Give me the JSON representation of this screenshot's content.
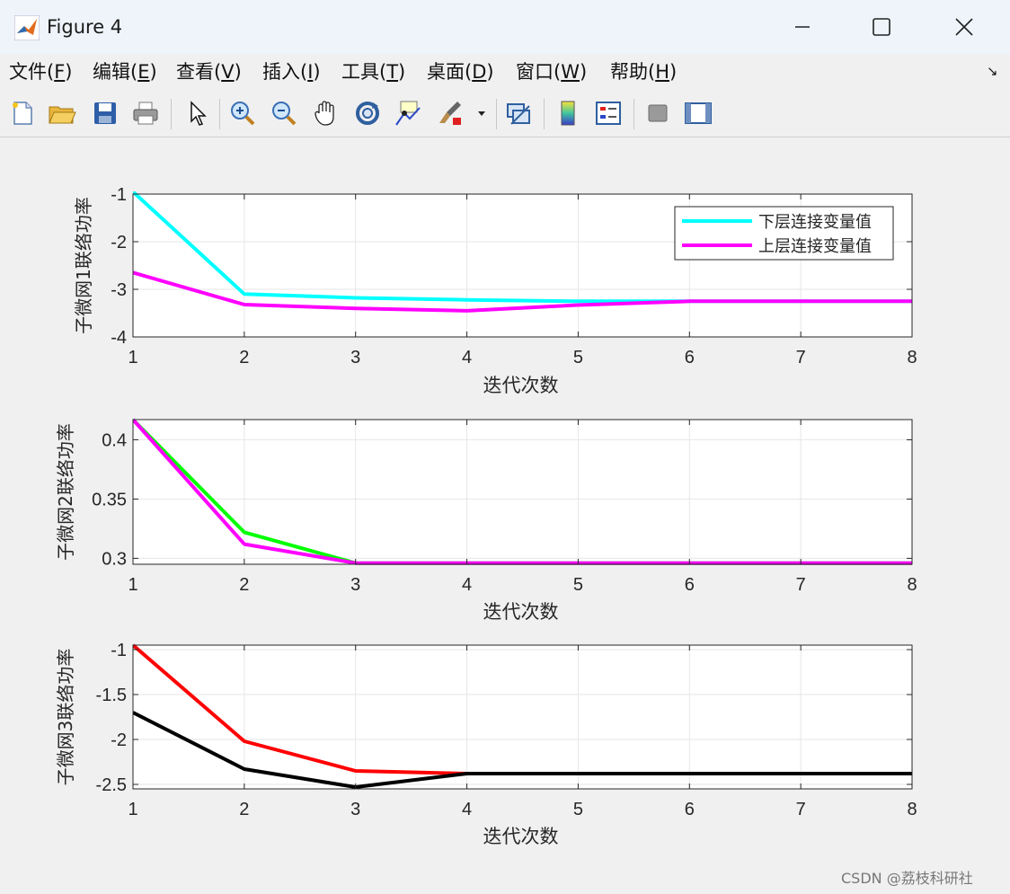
{
  "window": {
    "title": "Figure 4"
  },
  "menu": [
    {
      "pre": "文件(",
      "key": "F",
      "post": ")"
    },
    {
      "pre": "编辑(",
      "key": "E",
      "post": ")"
    },
    {
      "pre": "查看(",
      "key": "V",
      "post": ")"
    },
    {
      "pre": "插入(",
      "key": "I",
      "post": ")"
    },
    {
      "pre": "工具(",
      "key": "T",
      "post": ")"
    },
    {
      "pre": "桌面(",
      "key": "D",
      "post": ")"
    },
    {
      "pre": "窗口(",
      "key": "W",
      "post": ")"
    },
    {
      "pre": "帮助(",
      "key": "H",
      "post": ")"
    }
  ],
  "toolbar": {
    "icons": [
      "new-file-icon",
      "open-folder-icon",
      "save-icon",
      "print-icon",
      "pointer-icon",
      "zoom-in-icon",
      "zoom-out-icon",
      "pan-hand-icon",
      "rotate-3d-icon",
      "data-cursor-icon",
      "brush-icon",
      "link-plot-icon",
      "colorbar-icon",
      "legend-icon",
      "hide-plot-tools-icon",
      "show-plot-tools-icon"
    ]
  },
  "colors": {
    "cyan": "#00ffff",
    "magenta": "#ff00ff",
    "green": "#00ff00",
    "red": "#ff0000",
    "black": "#000000",
    "grid": "#e6e6e6",
    "axis": "#262626"
  },
  "chart_data": [
    {
      "type": "line",
      "xlabel": "迭代次数",
      "ylabel": "子微网1联络功率",
      "x": [
        1,
        2,
        3,
        4,
        5,
        6,
        7,
        8
      ],
      "xlim": [
        1,
        8
      ],
      "ylim": [
        -4,
        -1
      ],
      "xticks": [
        1,
        2,
        3,
        4,
        5,
        6,
        7,
        8
      ],
      "yticks": [
        -4,
        -3,
        -2,
        -1
      ],
      "grid": true,
      "legend": "top-right",
      "series": [
        {
          "name": "下层连接变量值",
          "color": "#00ffff",
          "values": [
            -0.95,
            -3.1,
            -3.18,
            -3.22,
            -3.25,
            -3.25,
            -3.25,
            -3.25
          ]
        },
        {
          "name": "上层连接变量值",
          "color": "#ff00ff",
          "values": [
            -2.65,
            -3.32,
            -3.4,
            -3.45,
            -3.33,
            -3.25,
            -3.25,
            -3.25
          ]
        }
      ]
    },
    {
      "type": "line",
      "xlabel": "迭代次数",
      "ylabel": "子微网2联络功率",
      "x": [
        1,
        2,
        3,
        4,
        5,
        6,
        7,
        8
      ],
      "xlim": [
        1,
        8
      ],
      "ylim": [
        0.295,
        0.417
      ],
      "xticks": [
        1,
        2,
        3,
        4,
        5,
        6,
        7,
        8
      ],
      "yticks": [
        0.3,
        0.35,
        0.4
      ],
      "grid": true,
      "series": [
        {
          "color": "#00ff00",
          "values": [
            0.417,
            0.322,
            0.296,
            0.296,
            0.296,
            0.296,
            0.296,
            0.296
          ]
        },
        {
          "color": "#ff00ff",
          "values": [
            0.417,
            0.312,
            0.296,
            0.296,
            0.296,
            0.296,
            0.296,
            0.296
          ]
        }
      ]
    },
    {
      "type": "line",
      "xlabel": "迭代次数",
      "ylabel": "子微网3联络功率",
      "x": [
        1,
        2,
        3,
        4,
        5,
        6,
        7,
        8
      ],
      "xlim": [
        1,
        8
      ],
      "ylim": [
        -2.55,
        -0.95
      ],
      "xticks": [
        1,
        2,
        3,
        4,
        5,
        6,
        7,
        8
      ],
      "yticks": [
        -2.5,
        -2,
        -1.5,
        -1
      ],
      "grid": true,
      "series": [
        {
          "color": "#ff0000",
          "values": [
            -0.95,
            -2.02,
            -2.35,
            -2.38,
            -2.38,
            -2.38,
            -2.38,
            -2.38
          ]
        },
        {
          "color": "#000000",
          "values": [
            -1.7,
            -2.33,
            -2.53,
            -2.38,
            -2.38,
            -2.38,
            -2.38,
            -2.38
          ]
        }
      ]
    }
  ],
  "watermark": "CSDN @荔枝科研社"
}
